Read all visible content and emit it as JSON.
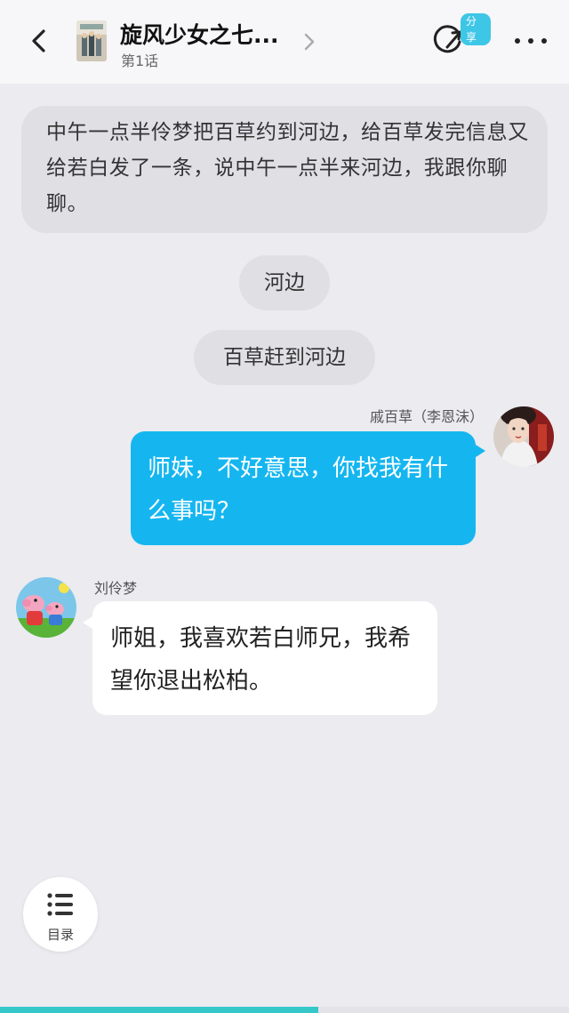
{
  "header": {
    "title": "旋风少女之七...",
    "episode": "第1话",
    "share_badge": "分享"
  },
  "narration": "中午一点半伶梦把百草约到河边，给百草发完信息又给若白发了一条，说中午一点半来河边，我跟你聊聊。",
  "scene_pills": [
    "河边",
    "百草赶到河边"
  ],
  "messages": [
    {
      "side": "right",
      "sender": "戚百草（李恩沫）",
      "text": "师妹，不好意思，你找我有什么事吗？"
    },
    {
      "side": "left",
      "sender": "刘伶梦",
      "text": "师姐，我喜欢若白师兄，我希望你退出松柏。"
    }
  ],
  "toc": {
    "label": "目录"
  },
  "reading_progress_fraction": 0.56,
  "colors": {
    "background": "#ebebf0",
    "bubble_right": "#15b6f0",
    "bubble_left": "#ffffff",
    "accent": "#36c8c8",
    "share_badge": "#3ec6e6"
  },
  "icons": [
    "back-arrow-icon",
    "book-cover",
    "chevron-right-icon",
    "share-icon",
    "more-icon",
    "list-icon"
  ]
}
